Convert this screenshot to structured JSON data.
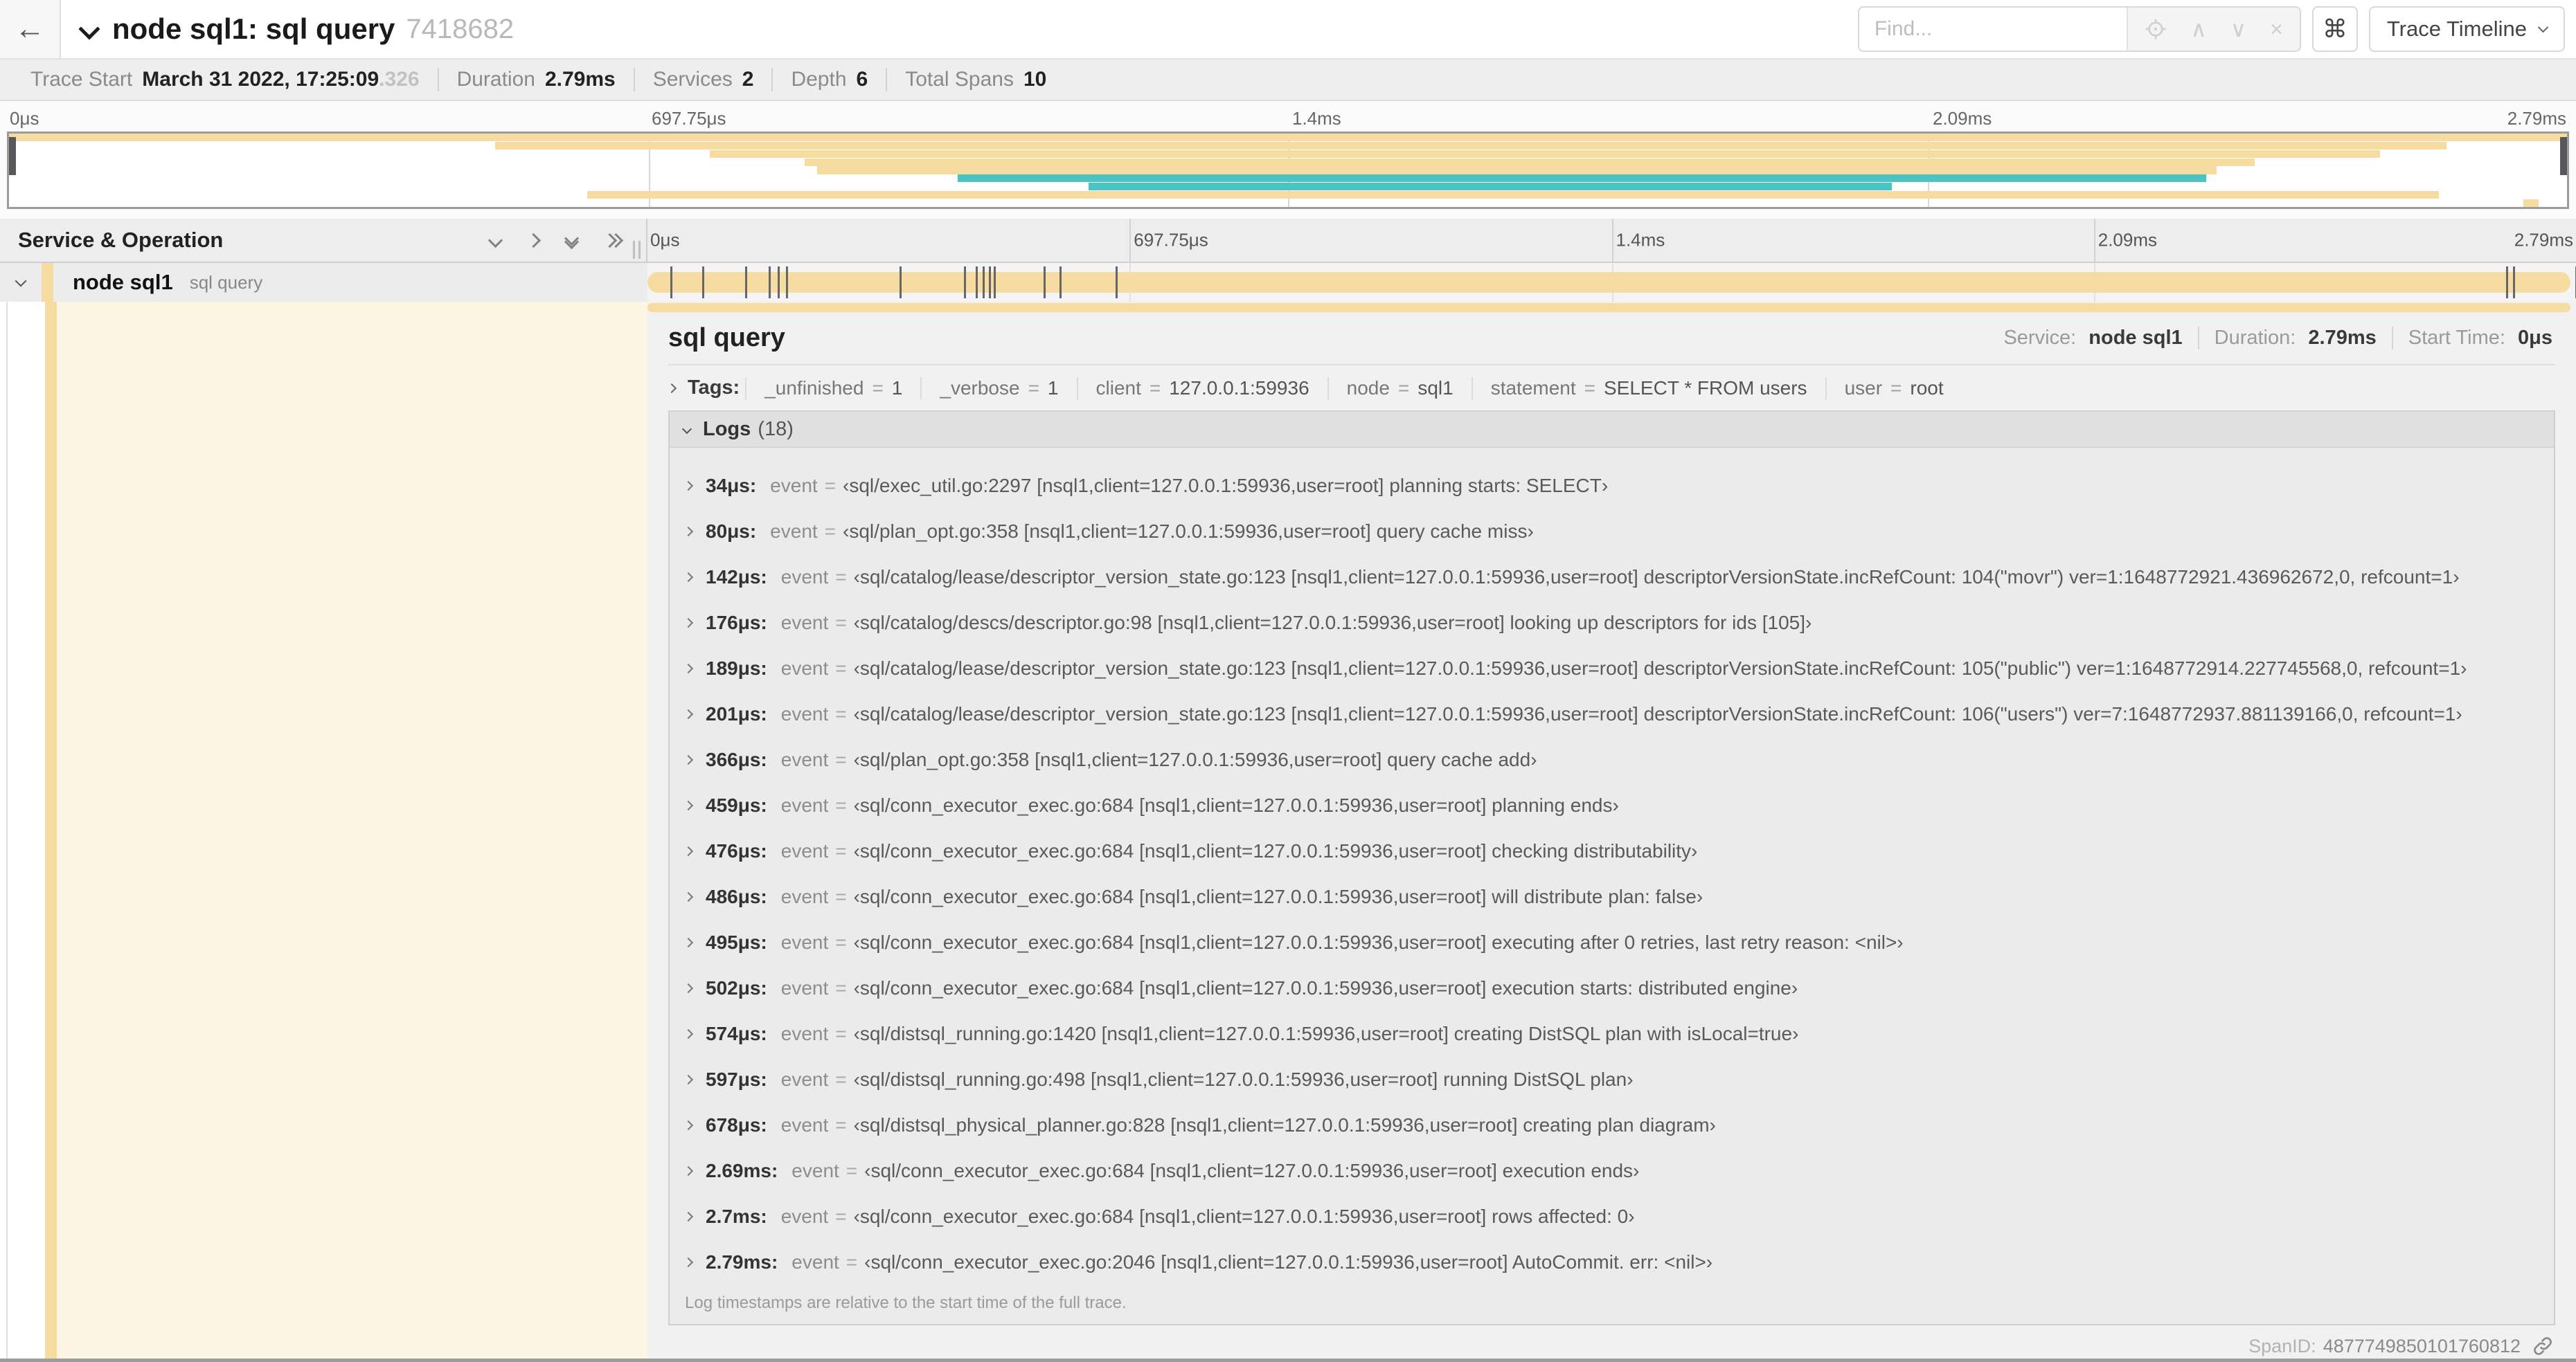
{
  "colors": {
    "tan": "#f7dca2",
    "teal": "#4ac4c0"
  },
  "header": {
    "back_icon": "←",
    "title": "node sql1: sql query",
    "trace_id": "7418682",
    "find_placeholder": "Find...",
    "prev_icon": "∧",
    "next_icon": "∨",
    "clear_icon": "×",
    "shortcut_icon": "⌘",
    "view_selector_label": "Trace Timeline"
  },
  "summary": {
    "items": [
      {
        "label": "Trace Start",
        "value": "March 31 2022, 17:25:09",
        "suffix": ".326"
      },
      {
        "label": "Duration",
        "value": "2.79ms",
        "suffix": ""
      },
      {
        "label": "Services",
        "value": "2",
        "suffix": ""
      },
      {
        "label": "Depth",
        "value": "6",
        "suffix": ""
      },
      {
        "label": "Total Spans",
        "value": "10",
        "suffix": ""
      }
    ]
  },
  "timeline": {
    "ticks": [
      "0μs",
      "697.75μs",
      "1.4ms",
      "2.09ms",
      "2.79ms"
    ],
    "col_header": "Service & Operation"
  },
  "minimap": {
    "spans": [
      {
        "row": 0,
        "start_pct": 0,
        "end_pct": 100,
        "color": "tan"
      },
      {
        "row": 1,
        "start_pct": 19,
        "end_pct": 95.3,
        "color": "tan"
      },
      {
        "row": 2,
        "start_pct": 27.4,
        "end_pct": 92.7,
        "color": "tan"
      },
      {
        "row": 3,
        "start_pct": 31.1,
        "end_pct": 87.8,
        "color": "tan"
      },
      {
        "row": 4,
        "start_pct": 31.6,
        "end_pct": 86.3,
        "color": "tan"
      },
      {
        "row": 5,
        "start_pct": 37.1,
        "end_pct": 85.9,
        "color": "teal"
      },
      {
        "row": 6,
        "start_pct": 42.2,
        "end_pct": 73.6,
        "color": "teal"
      },
      {
        "row": 7,
        "start_pct": 22.6,
        "end_pct": 95.0,
        "color": "tan"
      },
      {
        "row": 8,
        "start_pct": 98.3,
        "end_pct": 98.9,
        "color": "tan"
      }
    ]
  },
  "span_row": {
    "service": "node sql1",
    "operation": "sql query",
    "total_us": 2790,
    "event_times_us": [
      34,
      80,
      142,
      176,
      189,
      201,
      366,
      459,
      476,
      486,
      495,
      502,
      574,
      597,
      678,
      2690,
      2700,
      2790
    ]
  },
  "misc": {
    "eq": "=",
    "event_key": "event"
  },
  "detail": {
    "title": "sql query",
    "overview": [
      {
        "label": "Service:",
        "value": "node sql1"
      },
      {
        "label": "Duration:",
        "value": "2.79ms"
      },
      {
        "label": "Start Time:",
        "value": "0μs"
      }
    ],
    "tags_label": "Tags:",
    "tags": [
      {
        "key": "_unfinished",
        "value": "1"
      },
      {
        "key": "_verbose",
        "value": "1"
      },
      {
        "key": "client",
        "value": "127.0.0.1:59936"
      },
      {
        "key": "node",
        "value": "sql1"
      },
      {
        "key": "statement",
        "value": "SELECT * FROM users"
      },
      {
        "key": "user",
        "value": "root"
      }
    ],
    "logs_label": "Logs",
    "logs_count": "(18)",
    "logs": [
      {
        "time": "34μs:",
        "value": "‹sql/exec_util.go:2297 [nsql1,client=127.0.0.1:59936,user=root] planning starts: SELECT›"
      },
      {
        "time": "80μs:",
        "value": "‹sql/plan_opt.go:358 [nsql1,client=127.0.0.1:59936,user=root] query cache miss›"
      },
      {
        "time": "142μs:",
        "value": "‹sql/catalog/lease/descriptor_version_state.go:123 [nsql1,client=127.0.0.1:59936,user=root] descriptorVersionState.incRefCount: 104(\"movr\") ver=1:1648772921.436962672,0, refcount=1›"
      },
      {
        "time": "176μs:",
        "value": "‹sql/catalog/descs/descriptor.go:98 [nsql1,client=127.0.0.1:59936,user=root] looking up descriptors for ids [105]›"
      },
      {
        "time": "189μs:",
        "value": "‹sql/catalog/lease/descriptor_version_state.go:123 [nsql1,client=127.0.0.1:59936,user=root] descriptorVersionState.incRefCount: 105(\"public\") ver=1:1648772914.227745568,0, refcount=1›"
      },
      {
        "time": "201μs:",
        "value": "‹sql/catalog/lease/descriptor_version_state.go:123 [nsql1,client=127.0.0.1:59936,user=root] descriptorVersionState.incRefCount: 106(\"users\") ver=7:1648772937.881139166,0, refcount=1›"
      },
      {
        "time": "366μs:",
        "value": "‹sql/plan_opt.go:358 [nsql1,client=127.0.0.1:59936,user=root] query cache add›"
      },
      {
        "time": "459μs:",
        "value": "‹sql/conn_executor_exec.go:684 [nsql1,client=127.0.0.1:59936,user=root] planning ends›"
      },
      {
        "time": "476μs:",
        "value": "‹sql/conn_executor_exec.go:684 [nsql1,client=127.0.0.1:59936,user=root] checking distributability›"
      },
      {
        "time": "486μs:",
        "value": "‹sql/conn_executor_exec.go:684 [nsql1,client=127.0.0.1:59936,user=root] will distribute plan: false›"
      },
      {
        "time": "495μs:",
        "value": "‹sql/conn_executor_exec.go:684 [nsql1,client=127.0.0.1:59936,user=root] executing after 0 retries, last retry reason: <nil>›"
      },
      {
        "time": "502μs:",
        "value": "‹sql/conn_executor_exec.go:684 [nsql1,client=127.0.0.1:59936,user=root] execution starts: distributed engine›"
      },
      {
        "time": "574μs:",
        "value": "‹sql/distsql_running.go:1420 [nsql1,client=127.0.0.1:59936,user=root] creating DistSQL plan with isLocal=true›"
      },
      {
        "time": "597μs:",
        "value": "‹sql/distsql_running.go:498 [nsql1,client=127.0.0.1:59936,user=root] running DistSQL plan›"
      },
      {
        "time": "678μs:",
        "value": "‹sql/distsql_physical_planner.go:828 [nsql1,client=127.0.0.1:59936,user=root] creating plan diagram›"
      },
      {
        "time": "2.69ms:",
        "value": "‹sql/conn_executor_exec.go:684 [nsql1,client=127.0.0.1:59936,user=root] execution ends›"
      },
      {
        "time": "2.7ms:",
        "value": "‹sql/conn_executor_exec.go:684 [nsql1,client=127.0.0.1:59936,user=root] rows affected: 0›"
      },
      {
        "time": "2.79ms:",
        "value": "‹sql/conn_executor_exec.go:2046 [nsql1,client=127.0.0.1:59936,user=root] AutoCommit. err: <nil>›"
      }
    ],
    "logs_note": "Log timestamps are relative to the start time of the full trace.",
    "spanid_label": "SpanID:",
    "spanid_value": "4877749850101760812"
  }
}
